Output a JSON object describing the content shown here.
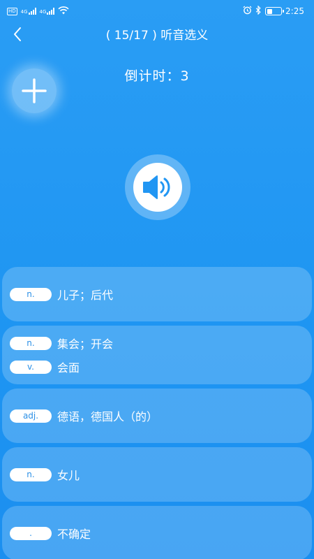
{
  "status_bar": {
    "left_icons": [
      "hd-icon",
      "4g-signal-icon",
      "4g-signal-icon",
      "wifi-icon"
    ],
    "net_label_1": "4G",
    "net_label_2": "4G",
    "hd_label": "HD",
    "right_icons": [
      "alarm-icon",
      "bluetooth-icon",
      "battery-icon"
    ],
    "time": "2:25"
  },
  "header": {
    "back_icon": "chevron-left-icon",
    "title": "( 15/17 ) 听音选义"
  },
  "countdown": {
    "text": "倒计时：3"
  },
  "add_button": {
    "icon": "plus-icon"
  },
  "play_button": {
    "icon": "speaker-icon"
  },
  "options": [
    {
      "meanings": [
        {
          "pos": "n.",
          "text": "儿子；后代"
        }
      ]
    },
    {
      "meanings": [
        {
          "pos": "n.",
          "text": "集会；开会"
        },
        {
          "pos": "v.",
          "text": "会面"
        }
      ]
    },
    {
      "meanings": [
        {
          "pos": "adj.",
          "text": "德语，德国人（的）"
        }
      ]
    },
    {
      "meanings": [
        {
          "pos": "n.",
          "text": "女儿"
        }
      ]
    },
    {
      "meanings": [
        {
          "pos": ".",
          "text": "不确定"
        }
      ]
    }
  ],
  "colors": {
    "background": "#2a9df4",
    "pos_text": "#2a8fe6",
    "speaker": "#2196f3"
  }
}
